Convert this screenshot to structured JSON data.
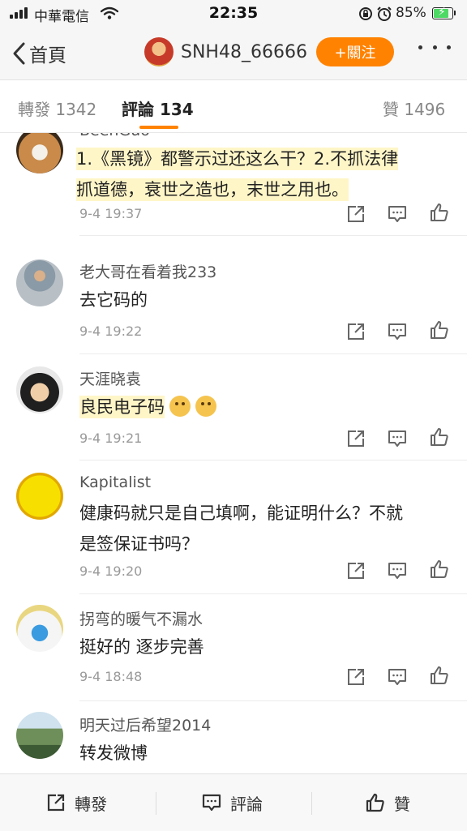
{
  "status_bar": {
    "carrier": "中華電信",
    "time": "22:35",
    "battery_percent": "85%",
    "battery_level": 0.85
  },
  "nav": {
    "back_label": "首頁",
    "username": "SNH48_66666",
    "follow_label": "+關注"
  },
  "tabs": [
    {
      "label": "轉發 1342",
      "active": false
    },
    {
      "label": "評論 134",
      "active": true
    },
    {
      "label": "贊 1496",
      "active": false
    }
  ],
  "comments": [
    {
      "name": "BeenGuo",
      "text_line1": "1.《黑镜》都警示过还这么干？2.不抓法律",
      "text_line2": "抓道德，衰世之造也，末世之用也。",
      "time": "9-4 19:37"
    },
    {
      "name": "老大哥在看着我233",
      "text": "去它码的",
      "time": "9-4 19:22"
    },
    {
      "name": "天涯晓袁",
      "text": "良民电子码",
      "time": "9-4 19:21"
    },
    {
      "name": "Kapitalist",
      "text_line1": "健康码就只是自己填啊，能证明什么？不就",
      "text_line2": "是签保证书吗？",
      "time": "9-4 19:20"
    },
    {
      "name": "拐弯的暖气不漏水",
      "text": "挺好的 逐步完善",
      "time": "9-4 18:48"
    },
    {
      "name": "明天过后希望2014",
      "text": "转发微博"
    }
  ],
  "bottom_bar": {
    "repost_label": "轉發",
    "comment_label": "評論",
    "like_label": "贊"
  },
  "colors": {
    "accent": "#ff8200",
    "highlight": "#fff6c8"
  },
  "icons": [
    "share-icon",
    "comment-icon",
    "like-icon",
    "back-chevron-icon",
    "more-dots-icon",
    "wifi-icon",
    "alarm-icon",
    "lock-rotation-icon"
  ]
}
